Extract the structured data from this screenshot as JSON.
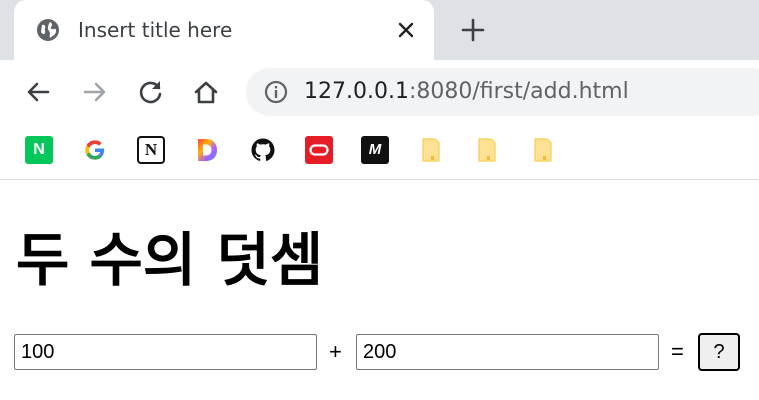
{
  "browser": {
    "tab": {
      "title": "Insert title here",
      "favicon": "globe-icon"
    },
    "address": {
      "host": "127.0.0.1",
      "rest": ":8080/first/add.html"
    },
    "bookmarks": [
      {
        "name": "naver",
        "glyph": "N",
        "color": "#03c75a"
      },
      {
        "name": "google",
        "glyph": "G"
      },
      {
        "name": "notion",
        "glyph": "N"
      },
      {
        "name": "daum",
        "glyph": "D"
      },
      {
        "name": "github",
        "glyph": ""
      },
      {
        "name": "oracle",
        "color": "#e41d26"
      },
      {
        "name": "medium",
        "glyph": "M"
      },
      {
        "name": "folder-1",
        "color": "#fde293"
      },
      {
        "name": "folder-2",
        "color": "#fde293"
      },
      {
        "name": "folder-3",
        "color": "#fde293"
      }
    ]
  },
  "page": {
    "heading": "두 수의 덧셈",
    "first_value": "100",
    "plus": "+",
    "second_value": "200",
    "equals": "=",
    "button_label": "?"
  }
}
